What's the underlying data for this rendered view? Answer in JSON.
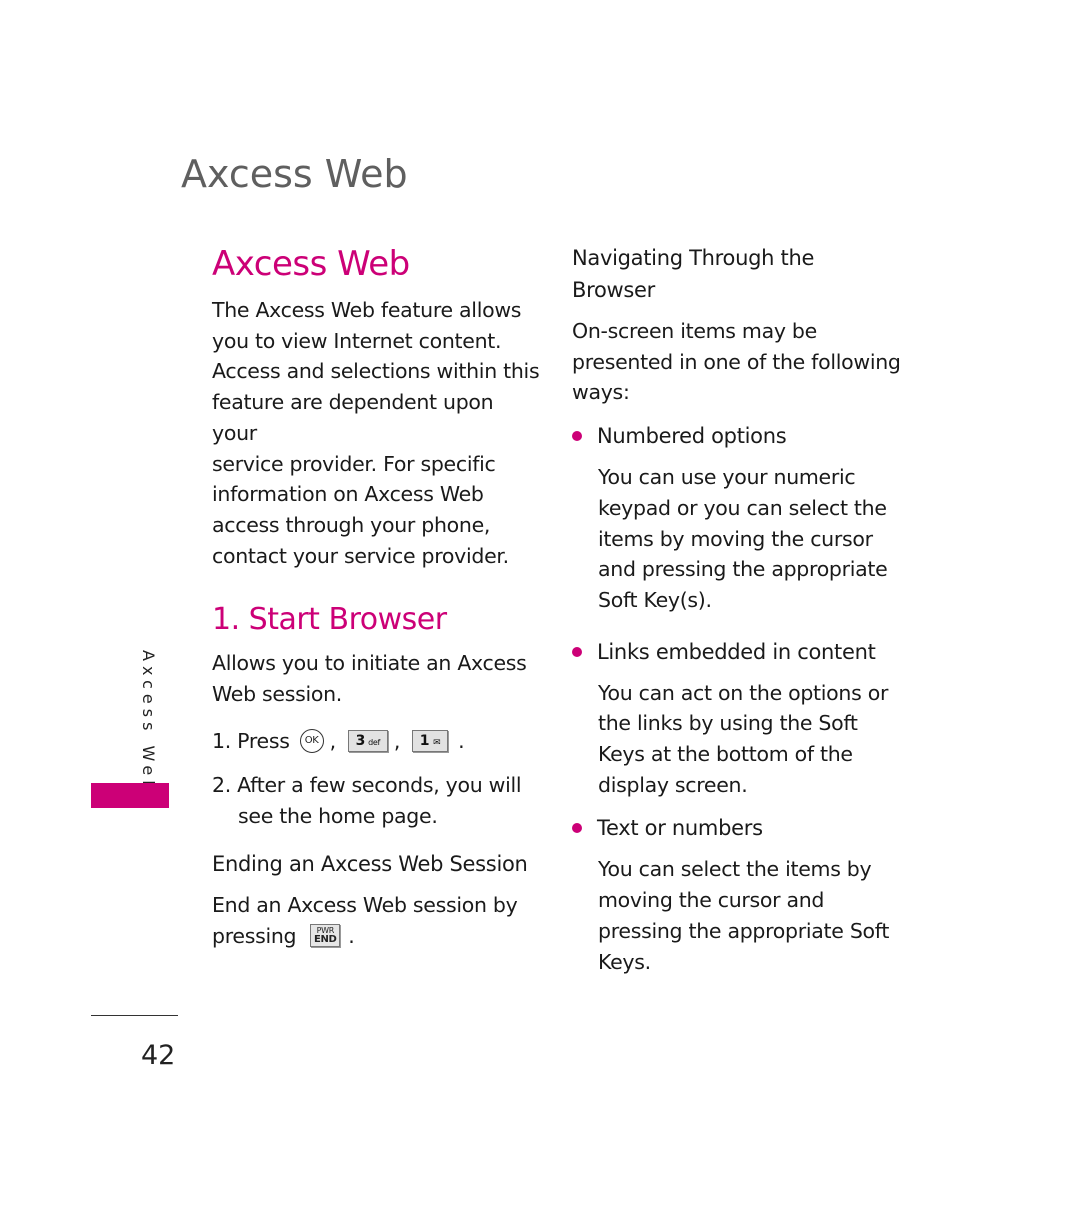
{
  "page": {
    "running_title": "Axcess Web",
    "side_tab": "Axcess Web",
    "page_number": "42",
    "accent_color": "#cc0077"
  },
  "left_column": {
    "title": "Axcess Web",
    "intro": [
      "The Axcess Web feature allows",
      "you to view Internet content.",
      "Access and selections within this",
      "feature are dependent upon your",
      "service provider. For specific",
      "information on Axcess Web",
      "access through your phone,",
      "contact your service provider."
    ],
    "section_title": "1. Start Browser",
    "section_desc": [
      "Allows you to initiate an Axcess",
      "Web session."
    ],
    "step1_prefix": "1. Press",
    "keys": {
      "ok": "OK",
      "three": "3",
      "three_sub": "def",
      "one": "1",
      "one_sub": "✉",
      "end_top": "PWR",
      "end_bottom": "END"
    },
    "sep_comma": ",",
    "sep_period": ".",
    "step2": [
      "2. After a few seconds, you will",
      "see the home page."
    ],
    "ending_title": "Ending an Axcess Web Session",
    "ending_line1": "End an Axcess Web session by",
    "ending_line2_prefix": "pressing"
  },
  "right_column": {
    "nav_title": [
      "Navigating Through the",
      "Browser"
    ],
    "nav_intro": [
      "On-screen items may be",
      "presented in one of the following",
      "ways:"
    ],
    "bullets": [
      {
        "title": "Numbered options",
        "lines": [
          "You can use your numeric",
          "keypad or you can select the",
          "items by moving the cursor",
          "and pressing the appropriate",
          "Soft Key(s)."
        ]
      },
      {
        "title": "Links embedded in content",
        "lines": [
          "You can act on the options or",
          "the links by using the Soft",
          "Keys at the bottom of the",
          "display screen."
        ]
      },
      {
        "title": "Text or numbers",
        "lines": [
          "You can select the items by",
          "moving the cursor and",
          "pressing the appropriate Soft",
          "Keys."
        ]
      }
    ]
  }
}
